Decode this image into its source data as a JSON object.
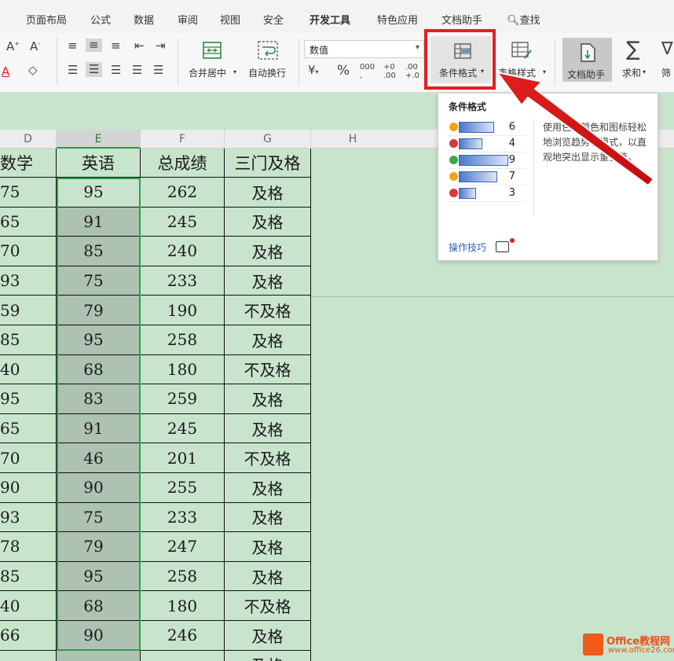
{
  "menu": [
    "页面布局",
    "公式",
    "数据",
    "审阅",
    "视图",
    "安全",
    "开发工具",
    "特色应用",
    "文档助手"
  ],
  "search_label": "查找",
  "toolbar": {
    "merge_center": "合并居中",
    "wrap_text": "自动换行",
    "number_format": "数值",
    "conditional_format": "条件格式",
    "table_style": "表格样式",
    "doc_helper": "文档助手",
    "sum": "求和",
    "filter": "筛"
  },
  "columns": [
    "D",
    "E",
    "F",
    "G",
    "H"
  ],
  "table": {
    "headers": [
      "数学",
      "英语",
      "总成绩",
      "三门及格"
    ],
    "rows": [
      [
        "75",
        "95",
        "262",
        "及格"
      ],
      [
        "65",
        "91",
        "245",
        "及格"
      ],
      [
        "70",
        "85",
        "240",
        "及格"
      ],
      [
        "93",
        "75",
        "233",
        "及格"
      ],
      [
        "59",
        "79",
        "190",
        "不及格"
      ],
      [
        "85",
        "95",
        "258",
        "及格"
      ],
      [
        "40",
        "68",
        "180",
        "不及格"
      ],
      [
        "95",
        "83",
        "259",
        "及格"
      ],
      [
        "65",
        "91",
        "245",
        "及格"
      ],
      [
        "70",
        "46",
        "201",
        "不及格"
      ],
      [
        "90",
        "90",
        "255",
        "及格"
      ],
      [
        "93",
        "75",
        "233",
        "及格"
      ],
      [
        "78",
        "79",
        "247",
        "及格"
      ],
      [
        "85",
        "95",
        "258",
        "及格"
      ],
      [
        "40",
        "68",
        "180",
        "不及格"
      ],
      [
        "66",
        "90",
        "246",
        "及格"
      ],
      [
        "",
        "",
        "",
        "及格"
      ]
    ]
  },
  "popup": {
    "title": "条件格式",
    "description": "使用色、颜色和图标轻松地浏览趋势和模式，以直观地突出显示重要值。",
    "preview_values": [
      "6",
      "4",
      "9",
      "7",
      "3"
    ],
    "preview_bar_fractions": [
      0.62,
      0.42,
      0.88,
      0.68,
      0.3
    ],
    "preview_icon_colors": [
      "#f2a31b",
      "#d83a3a",
      "#3da84a",
      "#f2a31b",
      "#d83a3a"
    ],
    "tips_label": "操作技巧"
  },
  "watermark": {
    "title": "Office教程网",
    "url": "www.office26.com"
  },
  "colors": {
    "sheet_bg": "#c9e4cd",
    "selection": "#2fa03f",
    "highlight": "#e02020"
  }
}
